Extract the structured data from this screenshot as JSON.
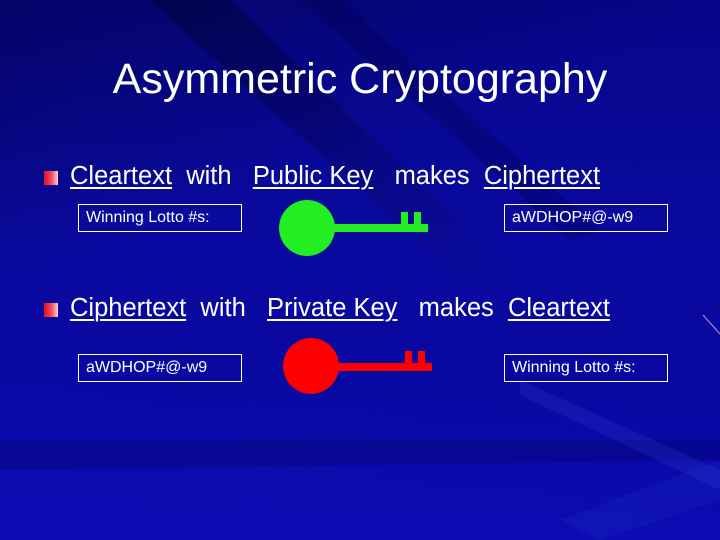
{
  "slide": {
    "title": "Asymmetric Cryptography",
    "colors": {
      "background": "#0808a0",
      "text": "#ffffff",
      "bullet": "#e01020",
      "public_key": "#22ee22",
      "private_key": "#ff0000"
    }
  },
  "bullets": [
    {
      "parts": [
        {
          "text": "Cleartext",
          "underline": true
        },
        {
          "text": "  with   ",
          "underline": false
        },
        {
          "text": "Public Key",
          "underline": true
        },
        {
          "text": "   makes  ",
          "underline": false
        },
        {
          "text": "Ciphertext",
          "underline": true
        }
      ],
      "input_box": "Winning Lotto #s:",
      "key_icon": "public-key-icon",
      "output_box": "aWDHOP#@-w9"
    },
    {
      "parts": [
        {
          "text": "Ciphertext",
          "underline": true
        },
        {
          "text": "  with   ",
          "underline": false
        },
        {
          "text": "Private Key",
          "underline": true
        },
        {
          "text": "   makes  ",
          "underline": false
        },
        {
          "text": "Cleartext",
          "underline": true
        }
      ],
      "input_box": "aWDHOP#@-w9",
      "key_icon": "private-key-icon",
      "output_box": "Winning Lotto #s:"
    }
  ]
}
